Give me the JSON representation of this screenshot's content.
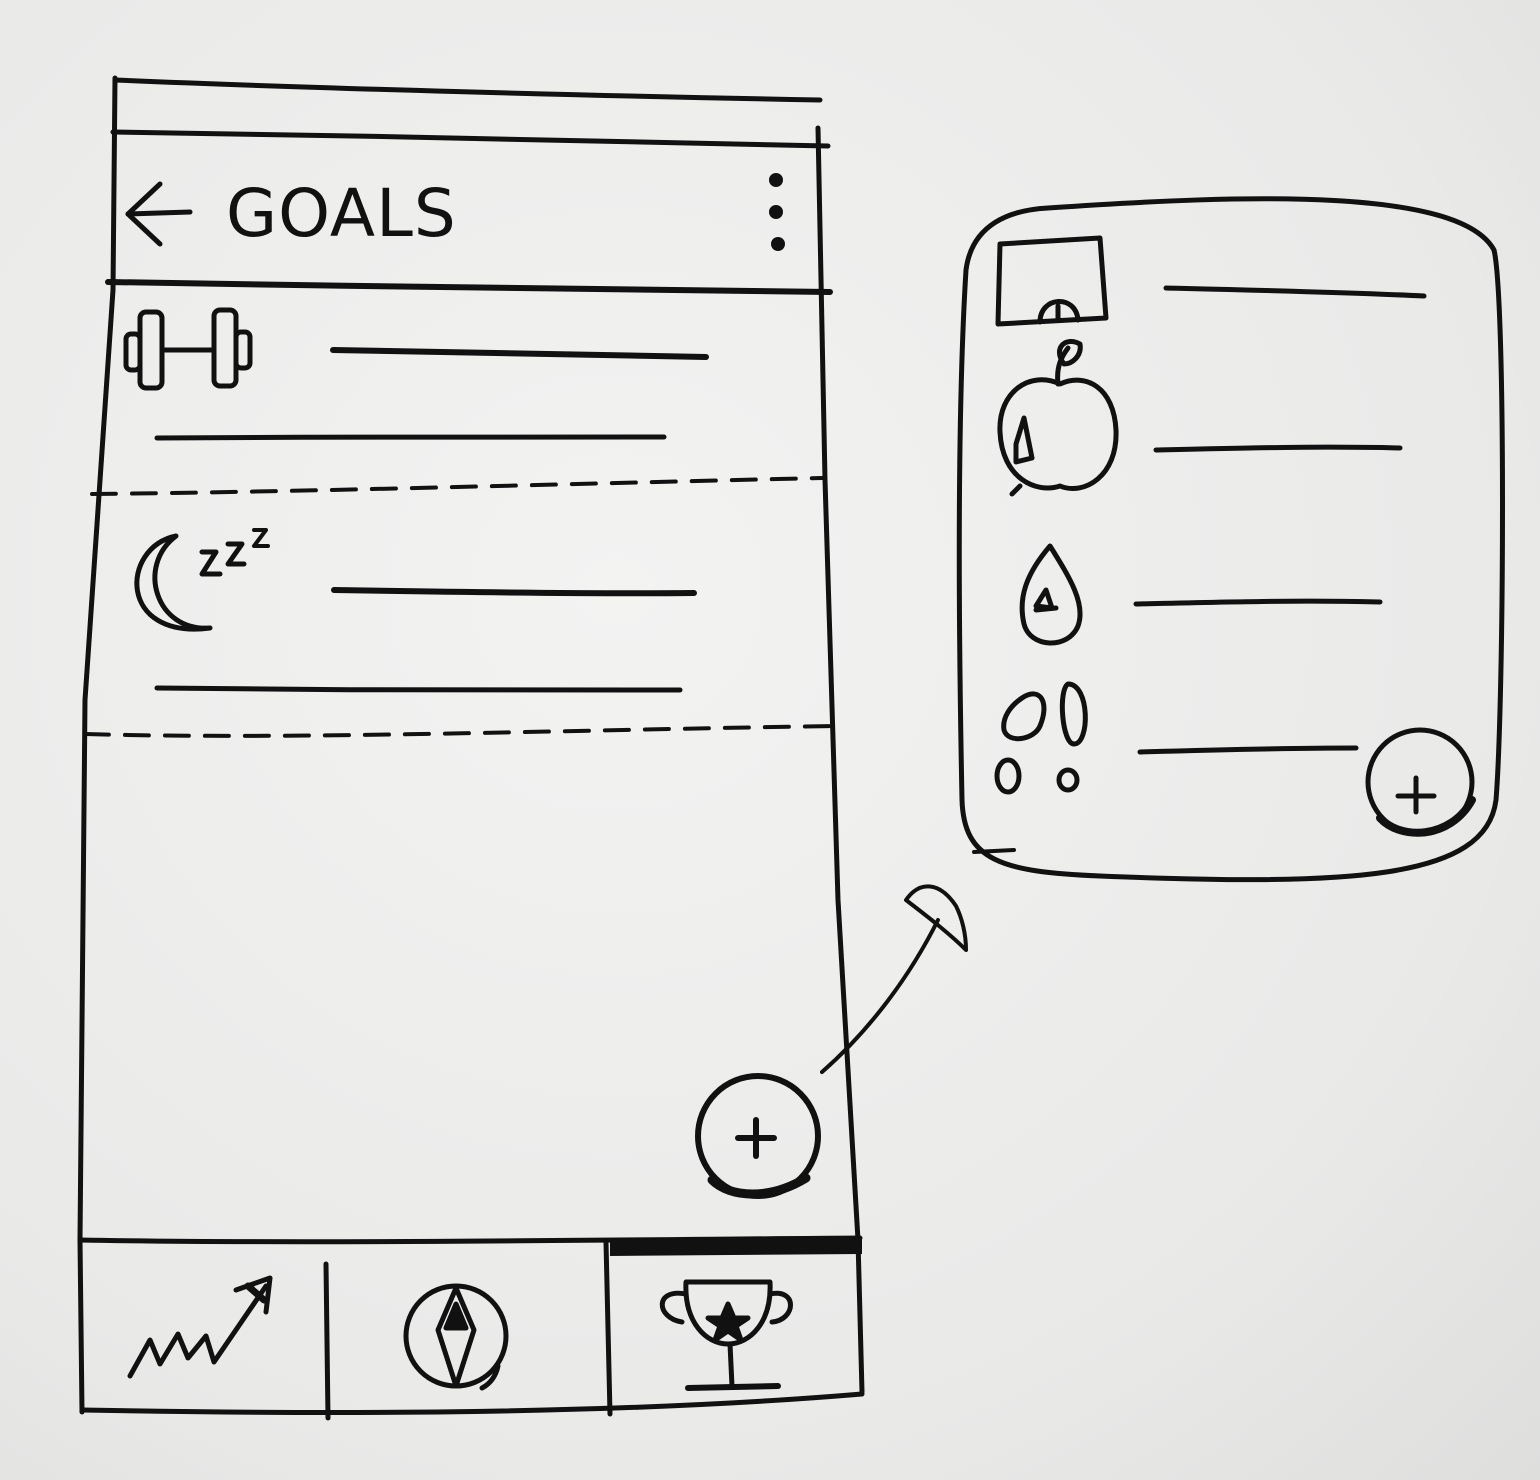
{
  "header": {
    "title": "GOALS",
    "back_icon": "arrow-left-icon",
    "menu_icon": "more-vertical-icon"
  },
  "goals_list": [
    {
      "icon": "dumbbell-icon"
    },
    {
      "icon": "moon-sleep-icon"
    }
  ],
  "fab": {
    "icon": "plus-icon"
  },
  "bottom_nav": [
    {
      "icon": "trending-up-icon",
      "selected": false
    },
    {
      "icon": "compass-icon",
      "selected": false
    },
    {
      "icon": "trophy-icon",
      "selected": true
    }
  ],
  "popup_menu": {
    "items": [
      {
        "icon": "scale-icon"
      },
      {
        "icon": "apple-icon"
      },
      {
        "icon": "water-drop-icon"
      },
      {
        "icon": "footsteps-icon"
      }
    ],
    "fab_icon": "plus-icon"
  },
  "colors": {
    "ink": "#111111",
    "paper": "#ececeb"
  }
}
